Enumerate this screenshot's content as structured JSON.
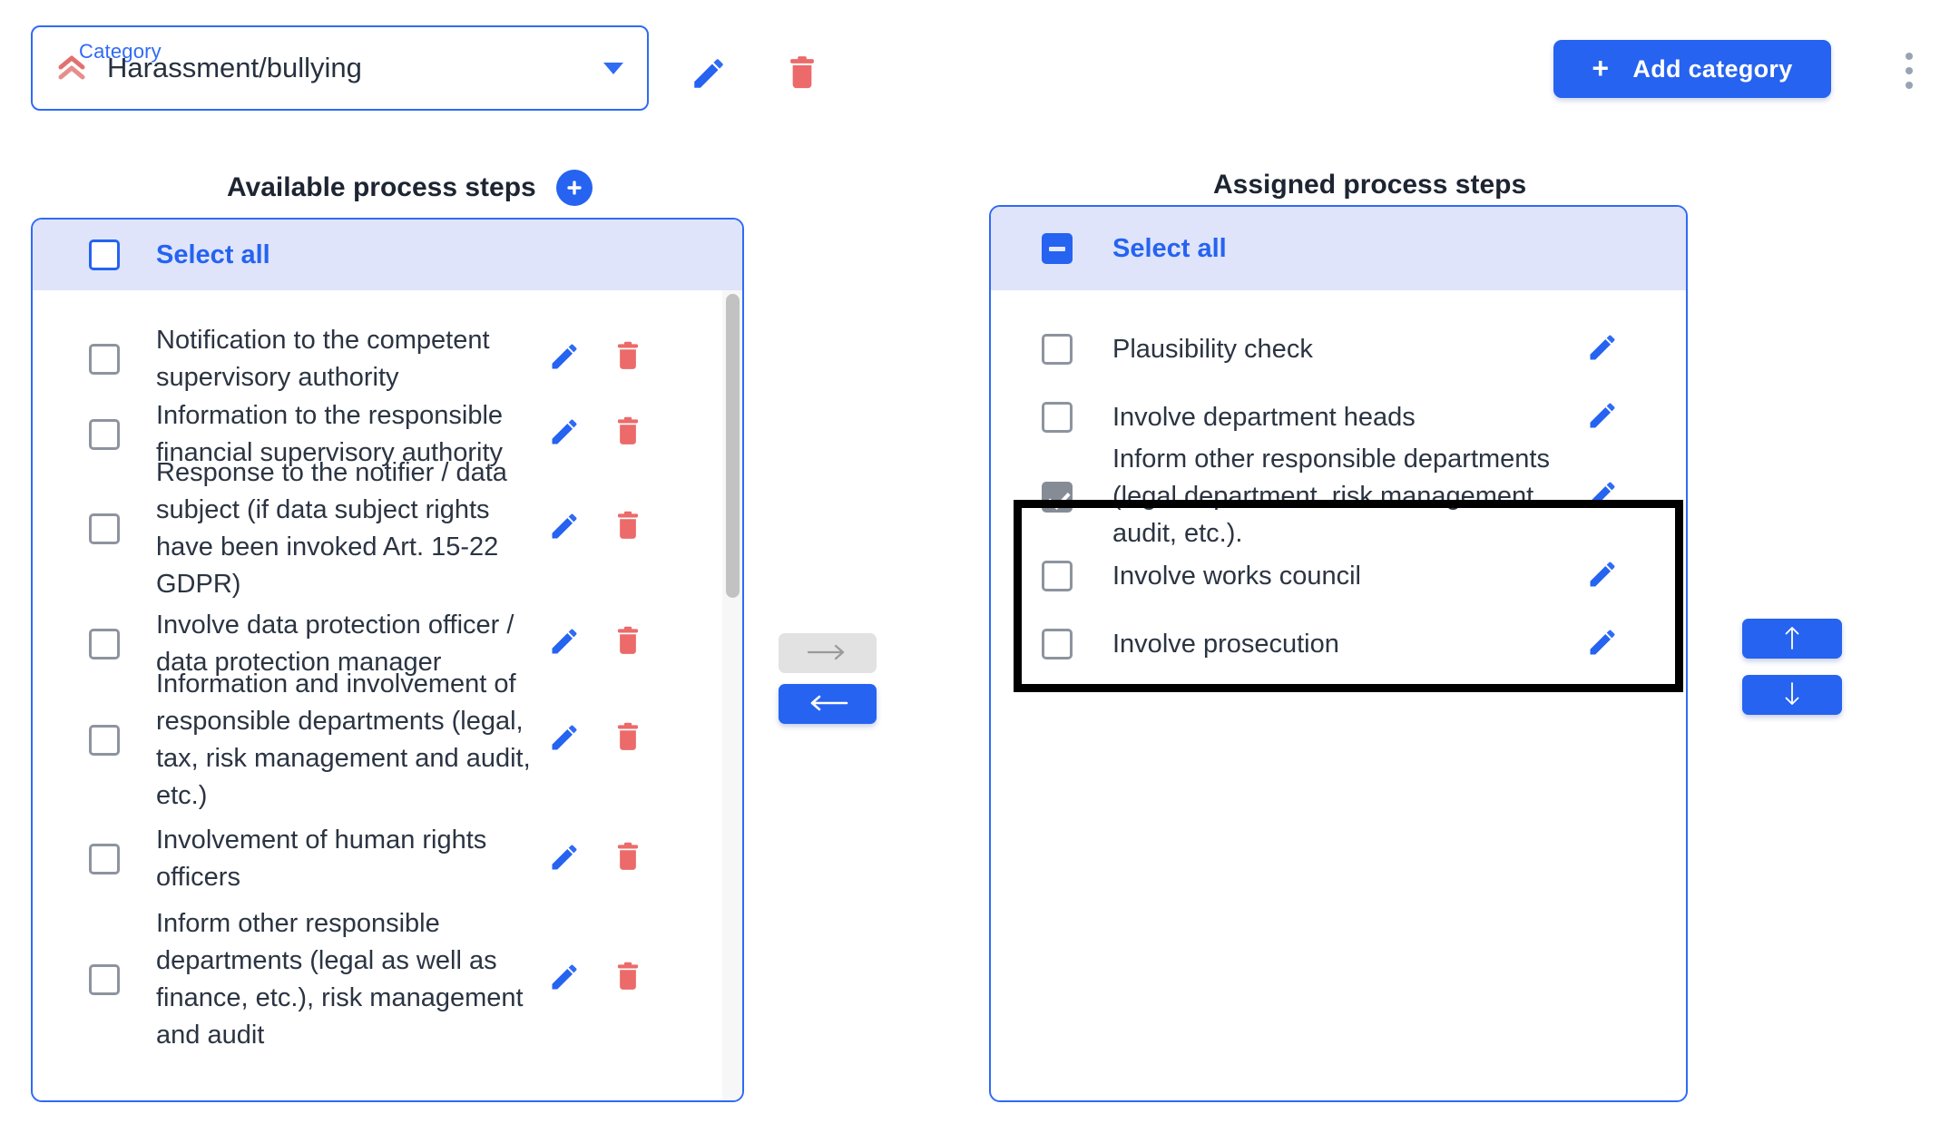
{
  "header": {
    "category_legend": "Category",
    "category_value": "Harassment/bullying",
    "category_icon": "double-chevron-up-icon",
    "dropdown_icon": "chevron-down-icon",
    "edit_icon": "pencil-icon",
    "delete_icon": "trash-icon",
    "add_category_label": "Add category",
    "add_category_plus": "+",
    "overflow_icon": "vertical-dots-icon",
    "accent_blue": "#2563f0",
    "accent_red": "#ec6a6a",
    "category_icon_color": "#e2706f"
  },
  "available": {
    "title": "Available process steps",
    "add_icon": "plus-circle-icon",
    "select_all_label": "Select all",
    "select_all_state": "unchecked",
    "items": [
      {
        "label": "Notification to the competent supervisory authority",
        "checked": false,
        "edit_icon": "pencil-icon",
        "delete_icon": "trash-icon"
      },
      {
        "label": "Information to the responsible financial supervisory authority",
        "checked": false,
        "edit_icon": "pencil-icon",
        "delete_icon": "trash-icon"
      },
      {
        "label": "Response to the notifier / data subject (if data subject rights have been invoked Art. 15-22 GDPR)",
        "checked": false,
        "edit_icon": "pencil-icon",
        "delete_icon": "trash-icon"
      },
      {
        "label": "Involve data protection officer / data protection manager",
        "checked": false,
        "edit_icon": "pencil-icon",
        "delete_icon": "trash-icon"
      },
      {
        "label": "Information and involvement of responsible departments (legal, tax, risk management and audit, etc.)",
        "checked": false,
        "edit_icon": "pencil-icon",
        "delete_icon": "trash-icon"
      },
      {
        "label": "Involvement of human rights officers",
        "checked": false,
        "edit_icon": "pencil-icon",
        "delete_icon": "trash-icon"
      },
      {
        "label": "Inform other responsible departments (legal as well as finance, etc.), risk management and audit",
        "checked": false,
        "edit_icon": "pencil-icon",
        "delete_icon": "trash-icon"
      }
    ]
  },
  "assigned": {
    "title": "Assigned process steps",
    "select_all_label": "Select all",
    "select_all_state": "indeterminate",
    "items": [
      {
        "label": "Plausibility check",
        "checked": false,
        "edit_icon": "pencil-icon"
      },
      {
        "label": "Involve department heads",
        "checked": false,
        "edit_icon": "pencil-icon"
      },
      {
        "label": "Inform other responsible departments (legal department, risk management, audit, etc.).",
        "checked": true,
        "edit_icon": "pencil-icon"
      },
      {
        "label": "Involve works council",
        "checked": false,
        "edit_icon": "pencil-icon"
      },
      {
        "label": "Involve prosecution",
        "checked": false,
        "edit_icon": "pencil-icon"
      }
    ]
  },
  "transfer": {
    "assign_icon": "arrow-right-icon",
    "assign_enabled": false,
    "unassign_icon": "arrow-left-icon",
    "unassign_enabled": true
  },
  "reorder": {
    "move_up_icon": "arrow-up-icon",
    "move_down_icon": "arrow-down-icon"
  },
  "annotation": {
    "highlight_color": "#000000"
  }
}
